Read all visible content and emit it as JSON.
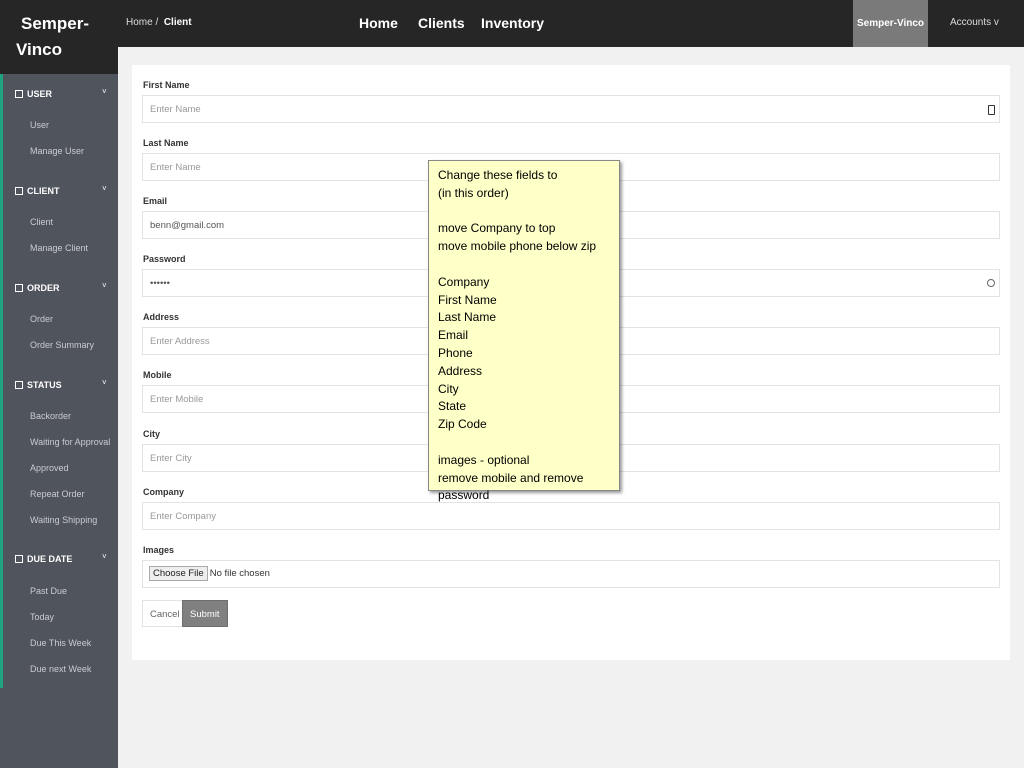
{
  "brand": {
    "line1": "Semper-",
    "line2": "Vinco"
  },
  "breadcrumb": {
    "home": "Home",
    "sep": "/",
    "current": "Client"
  },
  "nav": [
    "Home",
    "Clients",
    "Inventory"
  ],
  "account": {
    "brand": "Semper-Vinco",
    "menu": "Accounts v"
  },
  "sidebar": [
    {
      "title": "USER",
      "items": [
        "User",
        "Manage User"
      ]
    },
    {
      "title": "CLIENT",
      "items": [
        "Client",
        "Manage Client"
      ]
    },
    {
      "title": "ORDER",
      "items": [
        "Order",
        "Order Summary"
      ]
    },
    {
      "title": "STATUS",
      "items": [
        "Backorder",
        "Waiting for Approval",
        "Approved",
        "Repeat Order",
        "Waiting Shipping"
      ]
    },
    {
      "title": "DUE DATE",
      "items": [
        "Past Due",
        "Today",
        "Due This Week",
        "Due next Week"
      ]
    }
  ],
  "form": {
    "first_name": {
      "label": "First Name",
      "placeholder": "Enter Name"
    },
    "last_name": {
      "label": "Last Name",
      "placeholder": "Enter Name"
    },
    "email": {
      "label": "Email",
      "value": "benn@gmail.com"
    },
    "password": {
      "label": "Password",
      "value": "••••••"
    },
    "address": {
      "label": "Address",
      "placeholder": "Enter Address"
    },
    "mobile": {
      "label": "Mobile",
      "placeholder": "Enter Mobile"
    },
    "city": {
      "label": "City",
      "placeholder": "Enter City"
    },
    "company": {
      "label": "Company",
      "placeholder": "Enter Company"
    },
    "images": {
      "label": "Images",
      "button": "Choose File",
      "status": "No file chosen"
    },
    "cancel": "Cancel",
    "submit": "Submit"
  },
  "note": "Change these fields to\n(in this order)\n\nmove Company to top\nmove mobile phone below zip\n\nCompany\nFirst Name\nLast Name\nEmail\nPhone\nAddress\nCity\nState\nZip Code\n\nimages - optional\nremove mobile and remove password"
}
